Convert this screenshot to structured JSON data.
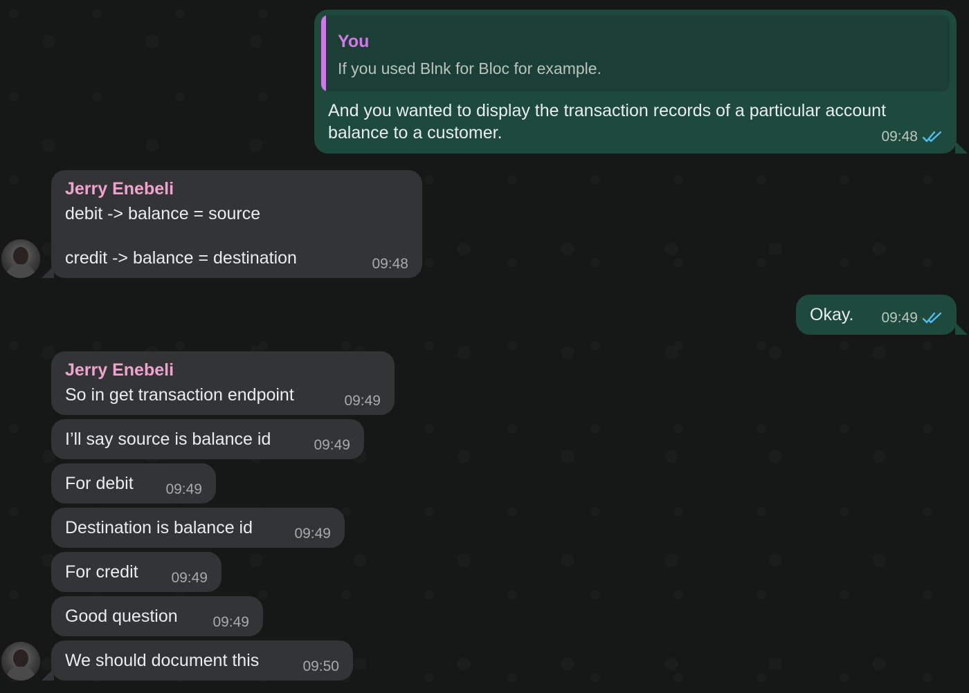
{
  "messages": {
    "m1": {
      "quote_sender": "You",
      "quote_text": "If you used Blnk for Bloc for example.",
      "line1": "And you wanted to display the transaction records of a particular account",
      "line2": "balance to a customer.",
      "time": "09:48",
      "status": "read"
    },
    "m2": {
      "sender": "Jerry Enebeli",
      "line1": "debit -> balance = source",
      "line2": "credit -> balance = destination",
      "time": "09:48"
    },
    "m3": {
      "text": "Okay.",
      "time": "09:49",
      "status": "read"
    },
    "m4": {
      "sender": "Jerry Enebeli",
      "text": "So in get transaction endpoint",
      "time": "09:49"
    },
    "m5": {
      "text": "I’ll say source is balance id",
      "time": "09:49"
    },
    "m6": {
      "text": "For debit",
      "time": "09:49"
    },
    "m7": {
      "text": "Destination is balance id",
      "time": "09:49"
    },
    "m8": {
      "text": "For credit",
      "time": "09:49"
    },
    "m9": {
      "text": "Good question",
      "time": "09:49"
    },
    "m10": {
      "text": "We should document this",
      "time": "09:50"
    }
  },
  "colors": {
    "background": "#161717",
    "incoming_bubble": "#333435",
    "outgoing_bubble": "#1d4a3c",
    "sender_name": "#f0a3cf",
    "quote_accent": "#d378e9",
    "read_ticks": "#53bdeb"
  },
  "icons": {
    "avatar": "contact-avatar",
    "read_receipt": "double-check-icon"
  }
}
